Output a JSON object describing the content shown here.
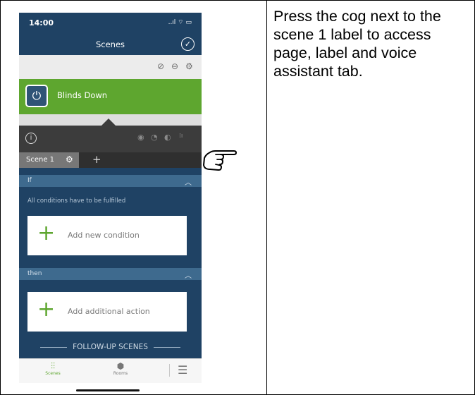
{
  "instruction": "Press the cog next to the scene 1 label to access page, label and voice assistant tab.",
  "status_bar": {
    "time": "14:00",
    "icons": "..ıl ⌔ ▭"
  },
  "nav": {
    "title": "Scenes"
  },
  "scene_row": {
    "label": "Blinds Down"
  },
  "tabs": {
    "active_tab": "Scene 1",
    "add": "+"
  },
  "conditions": {
    "header": "If",
    "note": "All conditions have to be fulfilled",
    "add_label": "Add new condition"
  },
  "actions": {
    "header": "then",
    "add_label": "Add additional action"
  },
  "follow_up": "FOLLOW-UP SCENES",
  "tabbar": {
    "scenes": "Scenes",
    "rooms": "Rooms"
  },
  "icons": [
    "check-circle-icon",
    "eye-slash-icon",
    "minus-circle-icon",
    "gear-icon",
    "power-icon",
    "info-icon",
    "radio-icon",
    "clock-icon",
    "contrast-icon",
    "stats-icon",
    "chevron-up-icon",
    "plus-icon",
    "sliders-icon",
    "cube-icon",
    "menu-icon",
    "pointing-hand-icon"
  ],
  "colors": {
    "navy": "#1f4264",
    "green": "#5ea62f",
    "dark": "#3c3c3c",
    "section_bar": "#3e6a8e"
  }
}
